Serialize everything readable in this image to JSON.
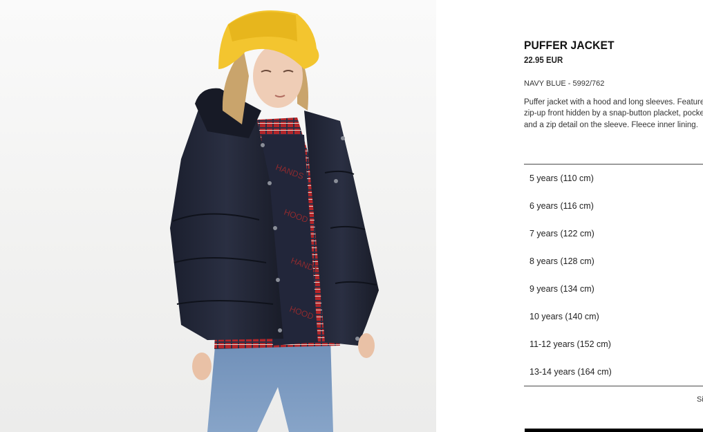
{
  "product": {
    "image_alt": "Child wearing a navy blue puffer jacket, yellow bucket hat, red plaid shirt and jeans",
    "name": "PUFFER JACKET",
    "price": "22.95 EUR",
    "color_ref": "NAVY BLUE - 5992/762",
    "description": "Puffer jacket with a hood and long sleeves. Features a zip-up front hidden by a snap-button placket, pockets and a zip detail on the sleeve. Fleece inner lining."
  },
  "sizes": [
    "5 years (110 cm)",
    "6 years (116 cm)",
    "7 years (122 cm)",
    "8 years (128 cm)",
    "9 years (134 cm)",
    "10 years (140 cm)",
    "11-12 years (152 cm)",
    "13-14 years (164 cm)"
  ],
  "size_guide_label": "Si",
  "colors": {
    "background": "#ffffff",
    "text": "#1a1a1a",
    "rule": "#4a4a4a",
    "button": "#000000"
  }
}
